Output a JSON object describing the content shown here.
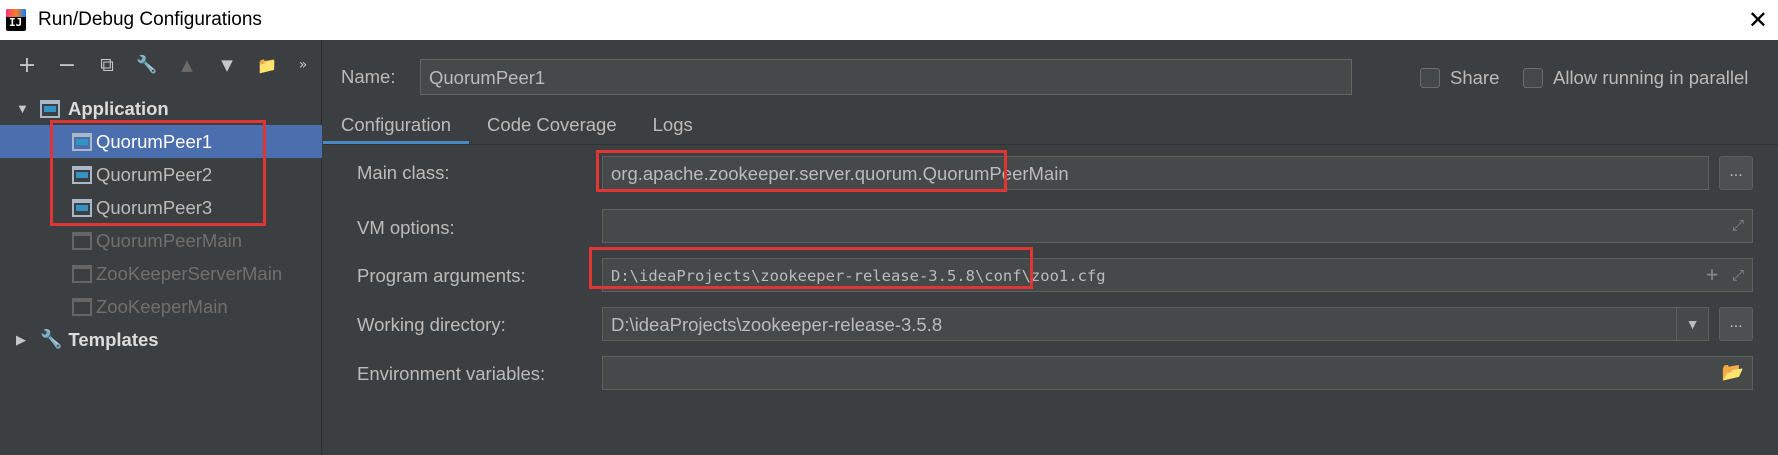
{
  "window": {
    "title": "Run/Debug Configurations",
    "icon_glyph": "IJ",
    "close_glyph": "✕"
  },
  "toolbar": {
    "add": "+",
    "remove": "−",
    "copy": "⧉",
    "settings": "🔧",
    "move_up": "▲",
    "move_down": "▼",
    "folder": "📁",
    "more": "»"
  },
  "tree": {
    "application": {
      "label": "Application",
      "arrow": "▼"
    },
    "items": [
      {
        "label": "QuorumPeer1",
        "selected": true,
        "enabled": true
      },
      {
        "label": "QuorumPeer2",
        "selected": false,
        "enabled": true
      },
      {
        "label": "QuorumPeer3",
        "selected": false,
        "enabled": true
      },
      {
        "label": "QuorumPeerMain",
        "selected": false,
        "enabled": false
      },
      {
        "label": "ZooKeeperServerMain",
        "selected": false,
        "enabled": false
      },
      {
        "label": "ZooKeeperMain",
        "selected": false,
        "enabled": false
      }
    ],
    "templates": {
      "label": "Templates",
      "arrow": "▶"
    }
  },
  "header": {
    "name_label": "Name:",
    "name_value": "QuorumPeer1",
    "share_label": "Share",
    "share_checked": false,
    "parallel_label": "Allow running in parallel",
    "parallel_checked": false
  },
  "tabs": [
    {
      "label": "Configuration",
      "active": true
    },
    {
      "label": "Code Coverage",
      "active": false
    },
    {
      "label": "Logs",
      "active": false
    }
  ],
  "form": {
    "main_class_label": "Main class:",
    "main_class_value": "org.apache.zookeeper.server.quorum.QuorumPeerMain",
    "vm_options_label": "VM options:",
    "vm_options_value": "",
    "program_args_label": "Program arguments:",
    "program_args_value": "D:\\ideaProjects\\zookeeper-release-3.5.8\\conf\\zoo1.cfg",
    "working_dir_label": "Working directory:",
    "working_dir_value": "D:\\ideaProjects\\zookeeper-release-3.5.8",
    "env_vars_label": "Environment variables:",
    "env_vars_value": "",
    "browse_label": "...",
    "expand_glyph": "⤢",
    "plus_glyph": "+",
    "dropdown_glyph": "▼",
    "folder_glyph": "📂"
  },
  "annotation": {
    "color": "#e03535"
  }
}
